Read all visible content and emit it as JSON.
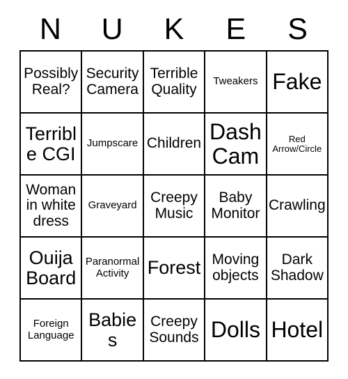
{
  "card": {
    "title_letters": [
      "N",
      "U",
      "K",
      "E",
      "S"
    ],
    "columns": 5,
    "rows": 5,
    "border_color": "#000000",
    "background_color": "#ffffff",
    "text_color": "#000000",
    "cells": [
      [
        {
          "label": "Possibly Real?",
          "size": "md"
        },
        {
          "label": "Security Camera",
          "size": "md"
        },
        {
          "label": "Terrible Quality",
          "size": "md"
        },
        {
          "label": "Tweakers",
          "size": "sm"
        },
        {
          "label": "Fake",
          "size": "xl"
        }
      ],
      [
        {
          "label": "Terrible CGI",
          "size": "lg"
        },
        {
          "label": "Jumpscare",
          "size": "sm"
        },
        {
          "label": "Children",
          "size": "md"
        },
        {
          "label": "Dash Cam",
          "size": "xl"
        },
        {
          "label": "Red Arrow/Circle",
          "size": "xs"
        }
      ],
      [
        {
          "label": "Woman in white dress",
          "size": "md"
        },
        {
          "label": "Graveyard",
          "size": "sm"
        },
        {
          "label": "Creepy Music",
          "size": "md"
        },
        {
          "label": "Baby Monitor",
          "size": "md"
        },
        {
          "label": "Crawling",
          "size": "md"
        }
      ],
      [
        {
          "label": "Ouija Board",
          "size": "lg"
        },
        {
          "label": "Paranormal Activity",
          "size": "sm"
        },
        {
          "label": "Forest",
          "size": "lg"
        },
        {
          "label": "Moving objects",
          "size": "md"
        },
        {
          "label": "Dark Shadow",
          "size": "md"
        }
      ],
      [
        {
          "label": "Foreign Language",
          "size": "sm"
        },
        {
          "label": "Babies",
          "size": "lg"
        },
        {
          "label": "Creepy Sounds",
          "size": "md"
        },
        {
          "label": "Dolls",
          "size": "xl"
        },
        {
          "label": "Hotel",
          "size": "xl"
        }
      ]
    ]
  }
}
